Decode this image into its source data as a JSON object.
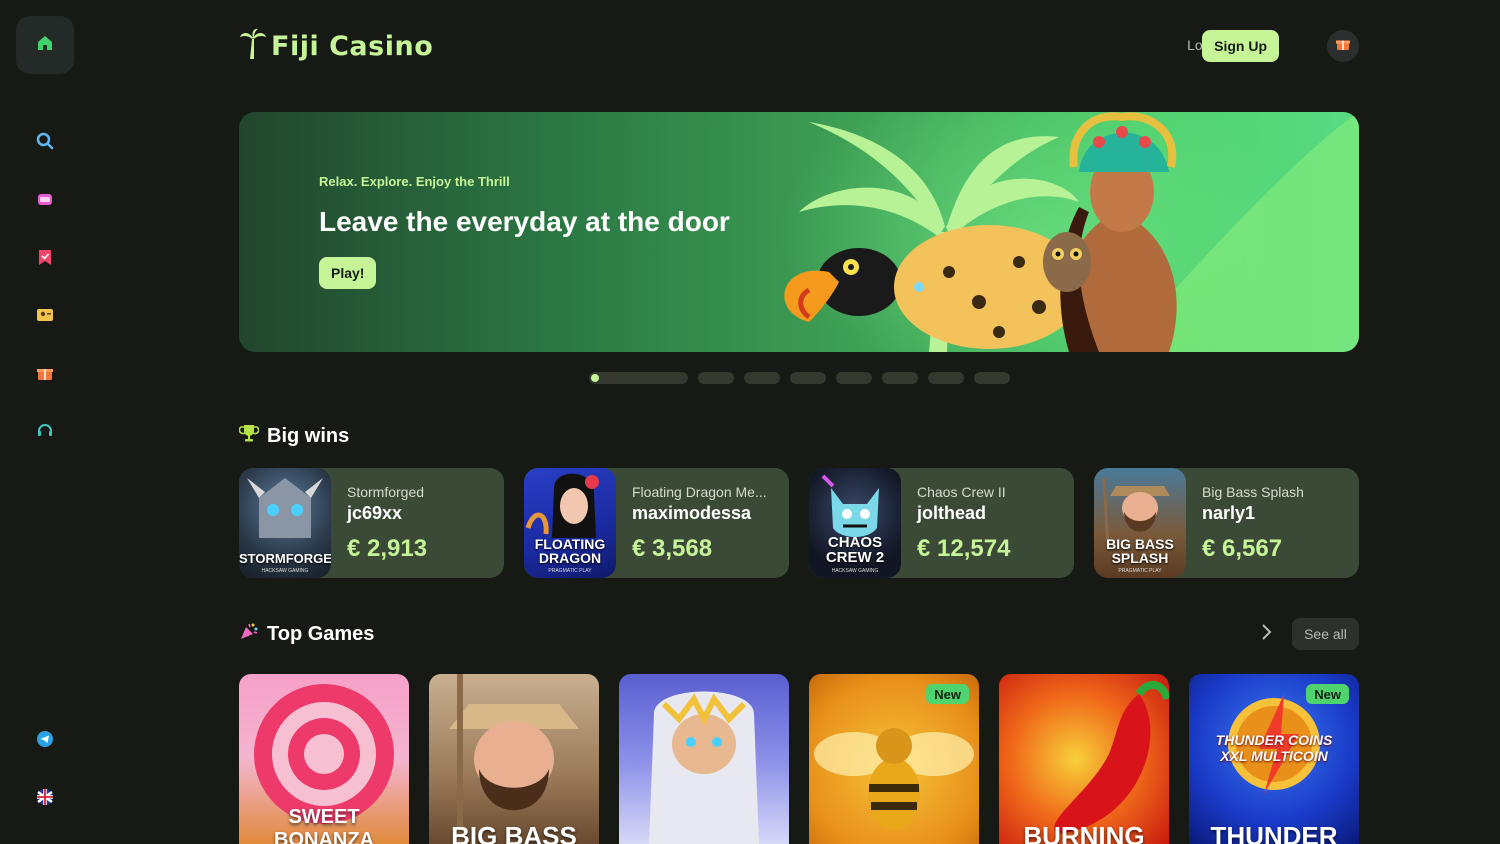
{
  "sidebar": {
    "items": [
      {
        "icon": "home-icon"
      },
      {
        "icon": "search-icon"
      },
      {
        "icon": "slot-machine-icon"
      },
      {
        "icon": "bookmark-icon"
      },
      {
        "icon": "live-casino-icon"
      },
      {
        "icon": "gift-icon"
      },
      {
        "icon": "support-icon"
      }
    ],
    "bottom": [
      {
        "icon": "telegram-icon"
      },
      {
        "icon": "language-uk-flag-icon"
      }
    ]
  },
  "header": {
    "logo_text": "Fiji Casino",
    "login_label": "Log In",
    "signup_label": "Sign Up"
  },
  "hero": {
    "tagline": "Relax. Explore. Enjoy the Thrill",
    "title": "Leave the everyday at the door",
    "play_label": "Play!",
    "slide_count": 8,
    "active_slide": 1
  },
  "big_wins": {
    "title": "Big wins",
    "items": [
      {
        "game": "Stormforged",
        "user": "jc69xx",
        "amount": "€ 2,913",
        "thumb_label": "STORMFORGED",
        "thumb_provider": "HACKSAW GAMING"
      },
      {
        "game": "Floating Dragon Me...",
        "user": "maximodessa",
        "amount": "€ 3,568",
        "thumb_label": "FLOATING DRAGON",
        "thumb_provider": "PRAGMATIC PLAY"
      },
      {
        "game": "Chaos Crew II",
        "user": "jolthead",
        "amount": "€ 12,574",
        "thumb_label": "CHAOS CREW 2",
        "thumb_provider": "HACKSAW GAMING"
      },
      {
        "game": "Big Bass Splash",
        "user": "narly1",
        "amount": "€ 6,567",
        "thumb_label": "BIG BASS SPLASH",
        "thumb_provider": "PRAGMATIC PLAY"
      }
    ]
  },
  "top_games": {
    "title": "Top Games",
    "see_all_label": "See all",
    "items": [
      {
        "title": "SWEET BONANZA",
        "badge": ""
      },
      {
        "title": "BIG BASS",
        "badge": ""
      },
      {
        "title": "",
        "badge": ""
      },
      {
        "title": "",
        "badge": "New"
      },
      {
        "title": "BURNING",
        "badge": ""
      },
      {
        "title": "THUNDER",
        "logo": "THUNDER COINS XXL MULTICOIN",
        "badge": "New"
      }
    ]
  }
}
